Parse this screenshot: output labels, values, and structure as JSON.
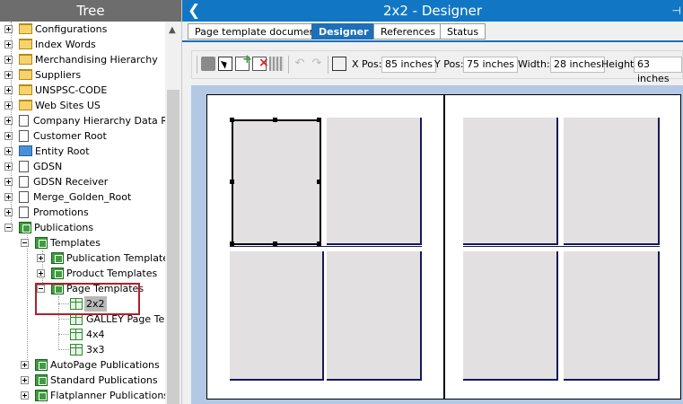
{
  "tree": {
    "title": "Tree",
    "items": [
      {
        "label": "Configurations",
        "icon": "folder-icon"
      },
      {
        "label": "Index Words",
        "icon": "folder-icon"
      },
      {
        "label": "Merchandising Hierarchy",
        "icon": "folder-icon"
      },
      {
        "label": "Suppliers",
        "icon": "folder-icon"
      },
      {
        "label": "UNSPSC-CODE",
        "icon": "folder-icon"
      },
      {
        "label": "Web Sites US",
        "icon": "folder-icon"
      },
      {
        "label": "Company Hierarchy Data Root",
        "icon": "document-icon"
      },
      {
        "label": "Customer Root",
        "icon": "document-icon"
      },
      {
        "label": "Entity Root",
        "icon": "entity-icon"
      },
      {
        "label": "GDSN",
        "icon": "document-icon"
      },
      {
        "label": "GDSN Receiver",
        "icon": "document-icon"
      },
      {
        "label": "Merge_Golden_Root",
        "icon": "document-icon"
      },
      {
        "label": "Promotions",
        "icon": "document-icon"
      },
      {
        "label": "Publications",
        "icon": "publication-icon"
      },
      {
        "label": "Templates",
        "icon": "publication-icon"
      },
      {
        "label": "Publication Templates",
        "icon": "publication-icon"
      },
      {
        "label": "Product Templates",
        "icon": "publication-icon"
      },
      {
        "label": "Page Templates",
        "icon": "publication-icon"
      },
      {
        "label": "2x2",
        "icon": "page-template-icon"
      },
      {
        "label": "GALLEY Page Tem",
        "icon": "page-template-icon"
      },
      {
        "label": "4x4",
        "icon": "page-template-icon"
      },
      {
        "label": "3x3",
        "icon": "page-template-icon"
      },
      {
        "label": "AutoPage Publications",
        "icon": "publication-icon"
      },
      {
        "label": "Standard Publications",
        "icon": "publication-icon"
      },
      {
        "label": "Flatplanner Publications",
        "icon": "publication-icon"
      }
    ]
  },
  "designer": {
    "title": "2x2 - Designer",
    "back_icon": "chevron-left-icon",
    "pin_icon": "pin-icon",
    "tabs": [
      {
        "label": "Page template document",
        "active": false
      },
      {
        "label": "Designer",
        "active": true
      },
      {
        "label": "References",
        "active": false
      },
      {
        "label": "Status",
        "active": false
      }
    ],
    "toolbar": {
      "xpos_label": "X Pos:",
      "xpos_value": "85 inches",
      "ypos_label": "Y Pos:",
      "ypos_value": "75 inches",
      "width_label": "Width:",
      "width_value": "28 inches",
      "height_label": "Height:",
      "height_value": "63 inches"
    }
  },
  "colors": {
    "header_blue": "#1177c4",
    "active_tab": "#1d6fb8",
    "tree_header": "#6d6d6d",
    "canvas_bg": "#b3c8e5",
    "highlight_box": "#b0202a"
  }
}
